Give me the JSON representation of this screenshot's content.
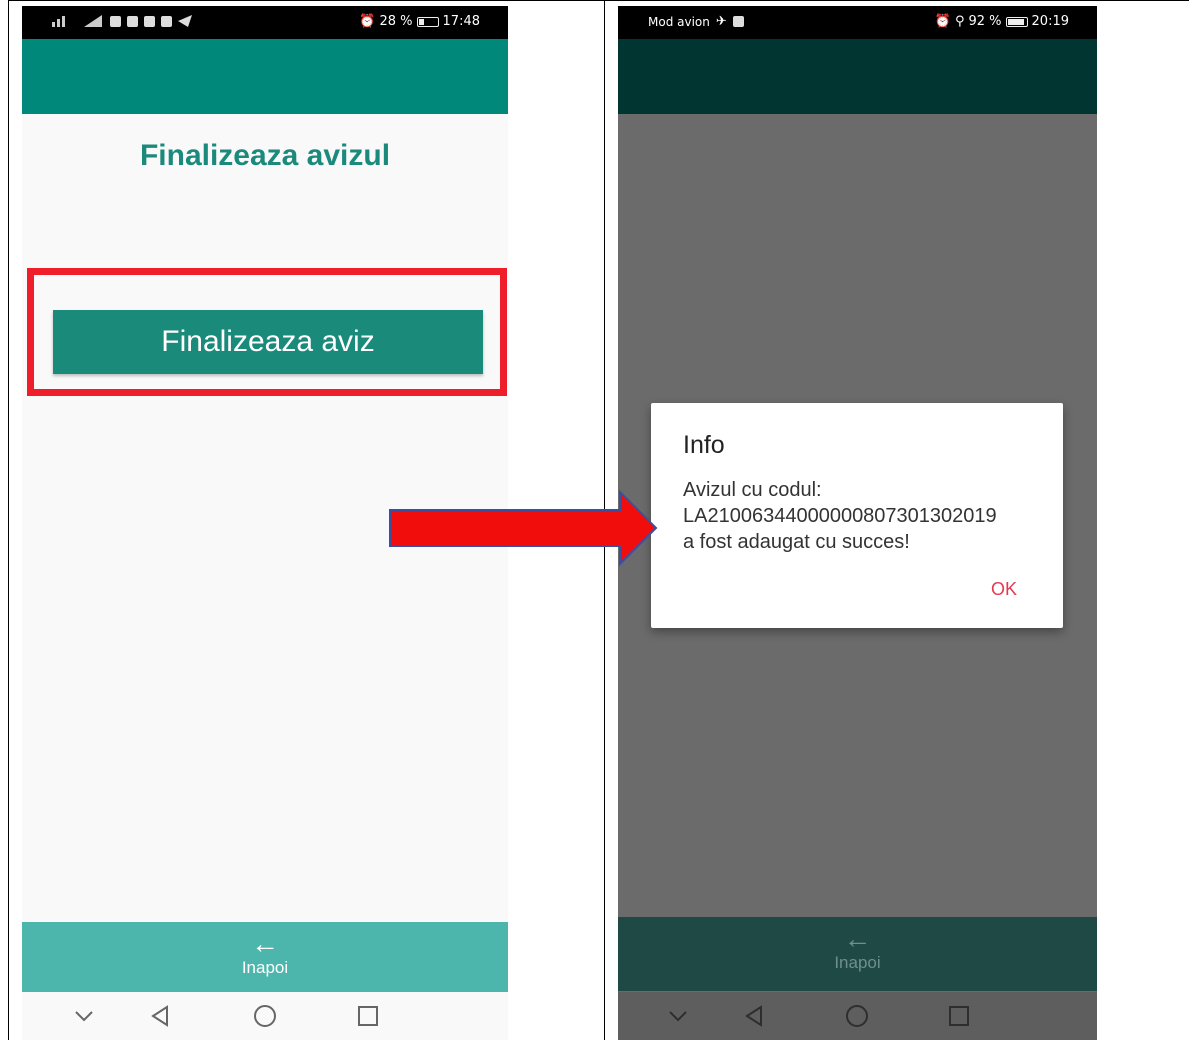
{
  "left_screen": {
    "status": {
      "battery": "28 %",
      "time": "17:48"
    },
    "title": "Finalizeaza avizul",
    "finalize_button": "Finalizeaza aviz",
    "back_arrow": "←",
    "back_label": "Inapoi",
    "colors": {
      "toolbar": "#00897b",
      "accent": "#1a8a7b",
      "highlight": "#ee1f2a",
      "bottom_bar": "#4db6ac"
    }
  },
  "right_screen": {
    "status": {
      "airplane_label": "Mod avion",
      "battery": "92 %",
      "time": "20:19"
    },
    "dialog": {
      "title": "Info",
      "line1": "Avizul cu codul:",
      "line2": "LA210063440000008073013020​19",
      "line3": "a fost adaugat cu succes!",
      "ok": "OK"
    },
    "back_arrow": "←",
    "back_label": "Inapoi",
    "colors": {
      "toolbar": "#003531",
      "scrim": "#6b6b6b",
      "bottom_bar": "#1f4945",
      "ok": "#e53950"
    }
  },
  "icons": [
    "signal-icon",
    "airplane-icon",
    "alarm-icon",
    "location-icon",
    "battery-icon",
    "back-arrow-icon",
    "nav-down-icon",
    "nav-back-icon",
    "nav-home-icon",
    "nav-recents-icon"
  ]
}
